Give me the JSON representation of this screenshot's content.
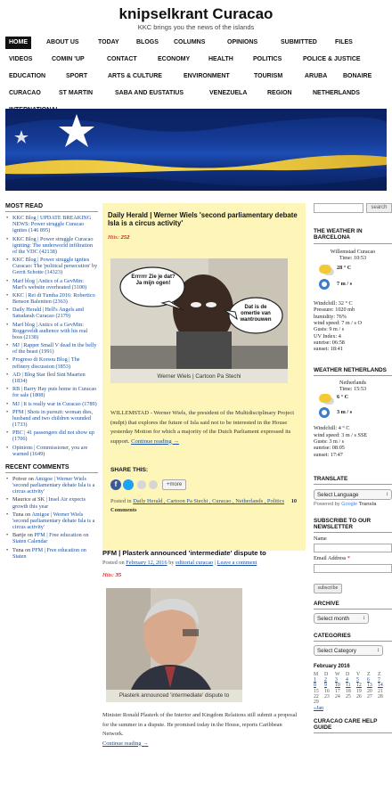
{
  "site": {
    "title": "knipselkrant Curacao",
    "tagline": "KKC brings you the news of the islands"
  },
  "nav": {
    "row1": [
      "HOME",
      "ABOUT US",
      "TODAY",
      "BLOGS",
      "COLUMNS",
      "OPINIONS",
      "SUBMITTED",
      "FILES"
    ],
    "row2": [
      "VIDEOS",
      "COMIN 'UP",
      "CONTACT",
      "ECONOMY",
      "HEALTH",
      "POLITICS",
      "POLICE & JUSTICE"
    ],
    "row3": [
      "EDUCATION",
      "SPORT",
      "ARTS & CULTURE",
      "ENVIRONMENT",
      "TOURISM",
      "ARUBA",
      "BONAIRE"
    ],
    "row4": [
      "CURACAO",
      "ST MARTIN",
      "SABA AND EUSTATIUS",
      "VENEZUELA",
      "REGION",
      "NETHERLANDS"
    ],
    "row5": [
      "INTERNATIONAL"
    ]
  },
  "most_read": {
    "title": "MOST READ",
    "items": [
      "KKC Blog | UPDATE BREAKING NEWS: Power struggle Curacao ignites (146 895)",
      "KKC Blog | Power struggle Curacao igniting: The underworld infiltration of the VDC (42138)",
      "KKC Blog | Power struggle ignites Curacao: The 'political persecution' by Gerrit Schotte (14323)",
      "Marf blog | Antics of a GevMin: Marf's website overheated (3100)",
      "KKC | Rei di Tumba 2016: Robertico Benson Balentien (2363)",
      "Daily Herald | Hell's Angels and Satudarah Curacao (2179)",
      "Marf blog | Antics of a GevMin: Roggeveldt audience with his real boss (2138)",
      "MJ | Rapper Small V dead in the belly of the beast (1991)",
      "Progreso di Korsou Blog | The refinery discussion (1853)",
      "AD | Blog Star fled Sint Maarten (1834)",
      "RB | Barry Hay puts home in Curacao for sale (1808)",
      "MJ | It is really war in Curacao (1789)",
      "PFM | Shots in pursuit: woman dies, husband and two children wounded (1733)",
      "PBC | 41 passengers did not show up (1706)",
      "Opinions | Commissioner, you are warned (1649)"
    ]
  },
  "recent_comments": {
    "title": "RECENT COMMENTS",
    "items": [
      {
        "author": "Potver on ",
        "link": "Amigoe | Werner Wiels 'second parliamentary debate Isla is a circus activity'"
      },
      {
        "author": "Maurice at SK ",
        "link": "| Insel Air expects growth this year"
      },
      {
        "author": "Tuna on ",
        "link": "Amigoe | Werner Wiels 'second parliamentary debate Isla is a circus activity'"
      },
      {
        "author": "Bartje on ",
        "link": "PFM | Free education on Staten Calendar"
      },
      {
        "author": "Tuna on ",
        "link": "PFM | Free education on Staten"
      }
    ]
  },
  "post1": {
    "title": "Daily Herald | Werner Wiels 'second parliamentary debate Isla is a circus activity'",
    "hits_label": "Hits:",
    "hits_value": "252",
    "bubble_left": "Errrrrr Zie je dat? Ja mijn ogen!",
    "bubble_right": "Dat is de omertie van wantrouwen",
    "caption": "Werner Wiels | Cartoon Pa Stechi",
    "excerpt": "WILLEMSTAD - Werner Wiels, the president of the Multidisciplinary Project (mdpt) that explores the future of Isla said not to be interested in the House yesterday Motion for which a majority of the Dutch Parliament expressed its support.",
    "read_more": "Continue reading →",
    "share_title": "SHARE THIS:",
    "share_more": "more",
    "posted_in_label": "Posted in",
    "categories": "Daily Herald , Cartoon Pa Stechi , Curacao , Netherlands , Politics",
    "comments": "10 Comments"
  },
  "post2": {
    "title": "PFM | Plasterk announced 'intermediate' dispute to",
    "posted_on": "Posted on",
    "date": "February 12, 2016",
    "by": "by",
    "author": "editorial curacao",
    "leave_comment": "Leave a comment",
    "hits_label": "Hits:",
    "hits_value": "35",
    "caption": "Plasterk announced 'intermediate' dispute to",
    "excerpt": "Minister Ronald Plasterk of the Interior and Kingdom Relations still submit a proposal for the summer in a dispute. He promised today in the House, reports Caribbean Network.",
    "read_more": "Continue reading →"
  },
  "right": {
    "search_button": "search",
    "weather1": {
      "title": "THE WEATHER IN BARCELONA",
      "city": "Willemstad Curacao",
      "time": "Time: 10:53",
      "temp": "28 ° C",
      "wind": "7 m / s",
      "details": [
        "Windchill: 32 ° C",
        "Pressure: 1020 mb",
        "humidity: 76%",
        "wind speed: 7 m / s O",
        "Gusts: 9 m / s",
        "UV Index: 4",
        "sunrise: 06:58",
        "sunset: 18:41"
      ]
    },
    "weather2": {
      "title": "WEATHER NETHERLANDS",
      "city": "Netherlands",
      "time": "Time: 15:53",
      "temp": "6 ° C",
      "wind": "3 m / s",
      "details": [
        "Windchill: 4 ° C",
        "wind speed: 3 m / s SSE",
        "Gusts: 3 m / s",
        "sunrise: 08:05",
        "sunset: 17:47"
      ]
    },
    "translate": {
      "title": "TRANSLATE",
      "select": "Select Language",
      "powered": "Powered by",
      "brand": "Google",
      "word": "Transla"
    },
    "subscribe": {
      "title": "SUBSCRIBE TO OUR NEWSLETTER",
      "name_label": "Name",
      "email_label": "Email Address",
      "required": "*",
      "button": "subscribe"
    },
    "archive": {
      "title": "ARCHIVE",
      "select": "Select month"
    },
    "categories": {
      "title": "CATEGORIES",
      "select": "Select Category"
    },
    "calendar": {
      "month": "February 2016",
      "headers": [
        "M",
        "D",
        "W",
        "D",
        "V",
        "Z",
        "Z"
      ],
      "rows": [
        [
          "1",
          "2",
          "3",
          "4",
          "5",
          "6",
          "7"
        ],
        [
          "8",
          "9",
          "10",
          "11",
          "12",
          "13",
          "14"
        ],
        [
          "15",
          "16",
          "17",
          "18",
          "19",
          "20",
          "21"
        ],
        [
          "22",
          "23",
          "24",
          "25",
          "26",
          "27",
          "28"
        ],
        [
          "29",
          "",
          "",
          "",
          "",
          "",
          ""
        ]
      ],
      "prev": "«Jan"
    },
    "care": {
      "title": "CURACAO CARE HELP GUIDE"
    }
  }
}
